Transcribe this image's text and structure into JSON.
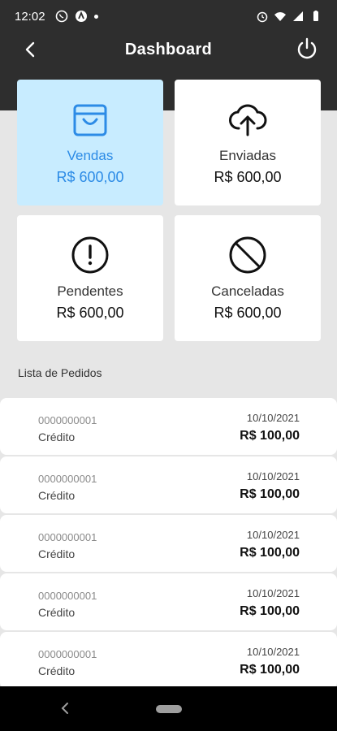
{
  "status_bar": {
    "time": "12:02"
  },
  "app_bar": {
    "title": "Dashboard"
  },
  "summary_cards": [
    {
      "label": "Vendas",
      "value": "R$ 600,00",
      "icon": "shopping-bag-icon",
      "active": true
    },
    {
      "label": "Enviadas",
      "value": "R$ 600,00",
      "icon": "cloud-upload-icon",
      "active": false
    },
    {
      "label": "Pendentes",
      "value": "R$ 600,00",
      "icon": "alert-circle-icon",
      "active": false
    },
    {
      "label": "Canceladas",
      "value": "R$ 600,00",
      "icon": "block-icon",
      "active": false
    }
  ],
  "orders_section": {
    "title": "Lista de Pedidos"
  },
  "orders": [
    {
      "id": "0000000001",
      "method": "Crédito",
      "date": "10/10/2021",
      "value": "R$ 100,00"
    },
    {
      "id": "0000000001",
      "method": "Crédito",
      "date": "10/10/2021",
      "value": "R$ 100,00"
    },
    {
      "id": "0000000001",
      "method": "Crédito",
      "date": "10/10/2021",
      "value": "R$ 100,00"
    },
    {
      "id": "0000000001",
      "method": "Crédito",
      "date": "10/10/2021",
      "value": "R$ 100,00"
    },
    {
      "id": "0000000001",
      "method": "Crédito",
      "date": "10/10/2021",
      "value": "R$ 100,00"
    }
  ],
  "colors": {
    "header_bg": "#2e2e2e",
    "active_card_bg": "#c8ecff",
    "accent": "#2c8be6"
  }
}
